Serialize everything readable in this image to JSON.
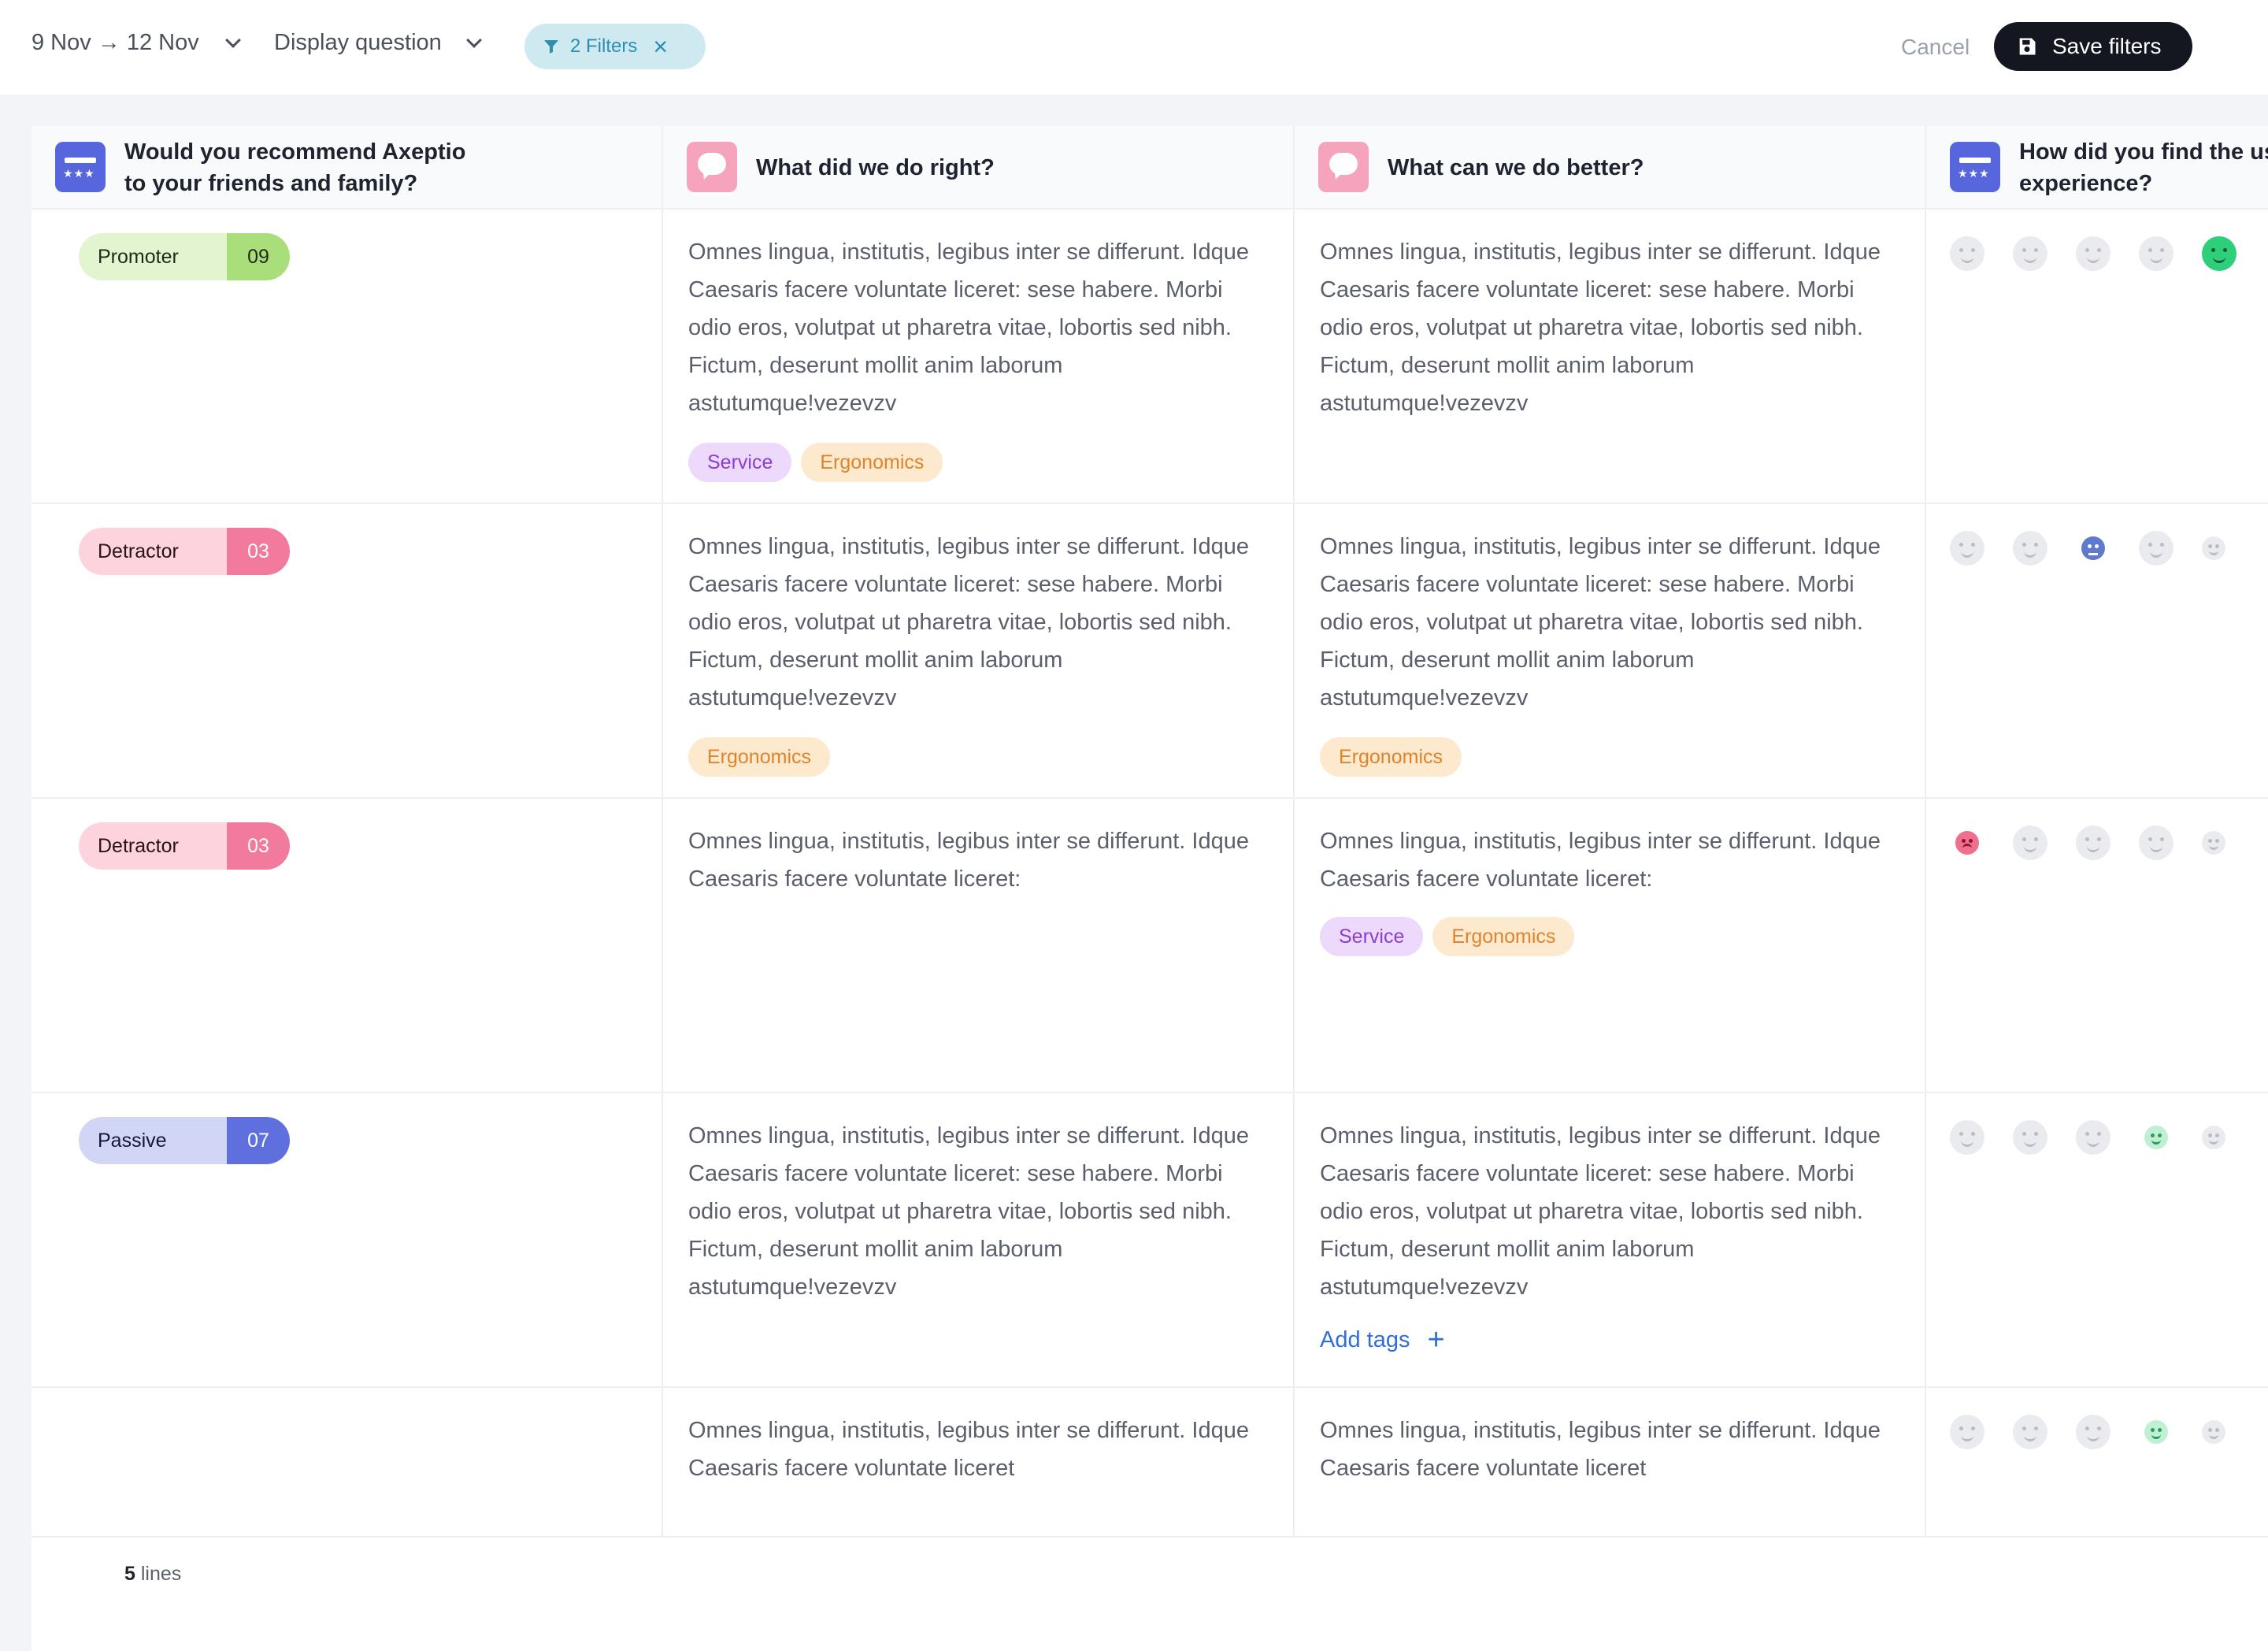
{
  "toolbar": {
    "date_range": "9 Nov → 12 Nov",
    "display_question": "Display question",
    "filters_label": "2 Filters",
    "cancel_label": "Cancel",
    "save_label": "Save filters"
  },
  "columns": [
    {
      "title_line1": "Would you recommend Axeptio",
      "title_line2": "to your friends and family?",
      "icon": "survey-icon"
    },
    {
      "title_line1": "What did we do right?",
      "title_line2": "",
      "icon": "comment-icon"
    },
    {
      "title_line1": "What can we do better?",
      "title_line2": "",
      "icon": "comment-icon"
    },
    {
      "title_line1": "How did you find the us",
      "title_line2": "experience?",
      "icon": "survey-icon"
    }
  ],
  "rows": [
    {
      "nps_label": "Promoter",
      "nps_score": "09",
      "right_text": "Omnes lingua, institutis, legibus inter se differunt. Idque Caesaris facere voluntate liceret: sese habere. Morbi odio eros, volutpat ut pharetra vitae, lobortis sed nibh. Fictum, deserunt mollit anim laborum astutumque!vezevzv",
      "right_tags": [
        "Service",
        "Ergonomics"
      ],
      "better_text": "Omnes lingua, institutis, legibus inter se differunt. Idque Caesaris facere voluntate liceret: sese habere. Morbi odio eros, volutpat ut pharetra vitae, lobortis sed nibh. Fictum, deserunt mollit anim laborum astutumque!vezevzv",
      "better_tags": [],
      "rating": 5
    },
    {
      "nps_label": "Detractor",
      "nps_score": "03",
      "right_text": "Omnes lingua, institutis, legibus inter se differunt. Idque Caesaris facere voluntate liceret: sese habere. Morbi odio eros, volutpat ut pharetra vitae, lobortis sed nibh. Fictum, deserunt mollit anim laborum astutumque!vezevzv",
      "right_tags": [
        "Ergonomics"
      ],
      "better_text": "Omnes lingua, institutis, legibus inter se differunt. Idque Caesaris facere voluntate liceret: sese habere. Morbi odio eros, volutpat ut pharetra vitae, lobortis sed nibh. Fictum, deserunt mollit anim laborum astutumque!vezevzv",
      "better_tags": [
        "Ergonomics"
      ],
      "rating": 3
    },
    {
      "nps_label": "Detractor",
      "nps_score": "03",
      "right_text": "Omnes lingua, institutis, legibus inter se differunt. Idque Caesaris facere voluntate liceret:",
      "right_tags": [],
      "better_text": "Omnes lingua, institutis, legibus inter se differunt. Idque Caesaris facere voluntate liceret:",
      "better_tags": [
        "Service",
        "Ergonomics"
      ],
      "rating": 1
    },
    {
      "nps_label": "Passive",
      "nps_score": "07",
      "right_text": "Omnes lingua, institutis, legibus inter se differunt. Idque Caesaris facere voluntate liceret: sese habere. Morbi odio eros, volutpat ut pharetra vitae, lobortis sed nibh. Fictum, deserunt mollit anim laborum astutumque!vezevzv",
      "right_tags": [],
      "better_text": "Omnes lingua, institutis, legibus inter se differunt. Idque Caesaris facere voluntate liceret: sese habere. Morbi odio eros, volutpat ut pharetra vitae, lobortis sed nibh. Fictum, deserunt mollit anim laborum astutumque!vezevzv",
      "better_add_tags": "Add tags",
      "rating": 4
    },
    {
      "nps_label": "",
      "nps_score": "",
      "right_text": "Omnes lingua, institutis, legibus inter se differunt. Idque Caesaris facere voluntate liceret",
      "right_tags": [],
      "better_text": "Omnes lingua, institutis, legibus inter se differunt. Idque Caesaris facere voluntate liceret",
      "better_tags": [],
      "rating": 4
    }
  ],
  "footer": {
    "count": "5",
    "count_label": "lines"
  },
  "colors": {
    "accent": "#5866dd",
    "save_button": "#14171f",
    "filter_pill": "#cfe9f1",
    "link": "#2f6fd6"
  }
}
